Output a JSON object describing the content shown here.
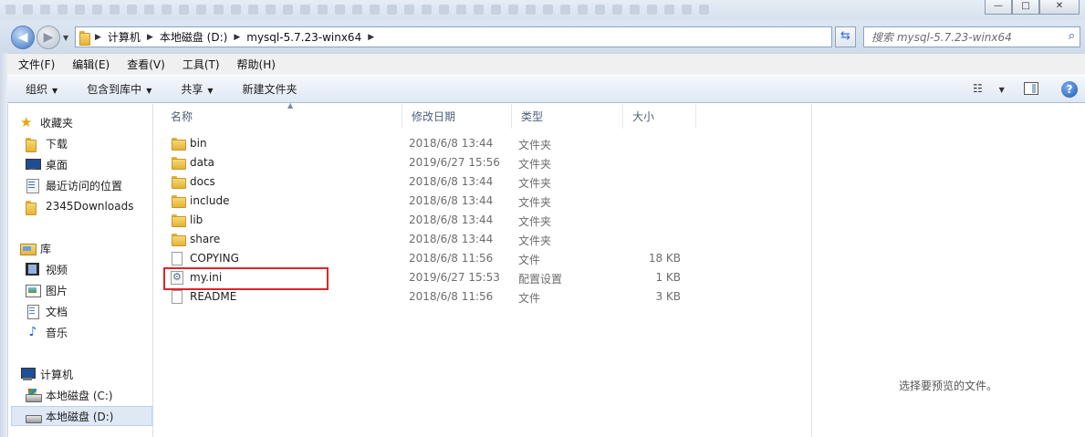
{
  "window": {
    "minimize_glyph": "—",
    "maximize_glyph": "□",
    "close_glyph": "✕"
  },
  "address": {
    "breadcrumbs": [
      "计算机",
      "本地磁盘 (D:)",
      "mysql-5.7.23-winx64"
    ],
    "search_placeholder": "搜索 mysql-5.7.23-winx64"
  },
  "menu": [
    "文件(F)",
    "编辑(E)",
    "查看(V)",
    "工具(T)",
    "帮助(H)"
  ],
  "toolbar": {
    "organize": "组织",
    "include_in_library": "包含到库中",
    "share": "共享",
    "new_folder": "新建文件夹"
  },
  "sidebar": {
    "favorites": {
      "label": "收藏夹",
      "items": [
        "下载",
        "桌面",
        "最近访问的位置",
        "2345Downloads"
      ]
    },
    "libraries": {
      "label": "库",
      "items": [
        "视频",
        "图片",
        "文档",
        "音乐"
      ]
    },
    "computer": {
      "label": "计算机",
      "items": [
        "本地磁盘 (C:)",
        "本地磁盘 (D:)"
      ],
      "selected": "本地磁盘 (D:)"
    }
  },
  "columns": {
    "name": "名称",
    "date": "修改日期",
    "type": "类型",
    "size": "大小"
  },
  "files": [
    {
      "name": "bin",
      "date": "2018/6/8 13:44",
      "type": "文件夹",
      "size": "",
      "kind": "folder"
    },
    {
      "name": "data",
      "date": "2019/6/27 15:56",
      "type": "文件夹",
      "size": "",
      "kind": "folder"
    },
    {
      "name": "docs",
      "date": "2018/6/8 13:44",
      "type": "文件夹",
      "size": "",
      "kind": "folder"
    },
    {
      "name": "include",
      "date": "2018/6/8 13:44",
      "type": "文件夹",
      "size": "",
      "kind": "folder"
    },
    {
      "name": "lib",
      "date": "2018/6/8 13:44",
      "type": "文件夹",
      "size": "",
      "kind": "folder"
    },
    {
      "name": "share",
      "date": "2018/6/8 13:44",
      "type": "文件夹",
      "size": "",
      "kind": "folder"
    },
    {
      "name": "COPYING",
      "date": "2018/6/8 11:56",
      "type": "文件",
      "size": "18 KB",
      "kind": "file"
    },
    {
      "name": "my.ini",
      "date": "2019/6/27 15:53",
      "type": "配置设置",
      "size": "1 KB",
      "kind": "ini"
    },
    {
      "name": "README",
      "date": "2018/6/8 11:56",
      "type": "文件",
      "size": "3 KB",
      "kind": "file"
    }
  ],
  "highlight_color": "#e0242a",
  "preview": {
    "empty_text": "选择要预览的文件。"
  }
}
